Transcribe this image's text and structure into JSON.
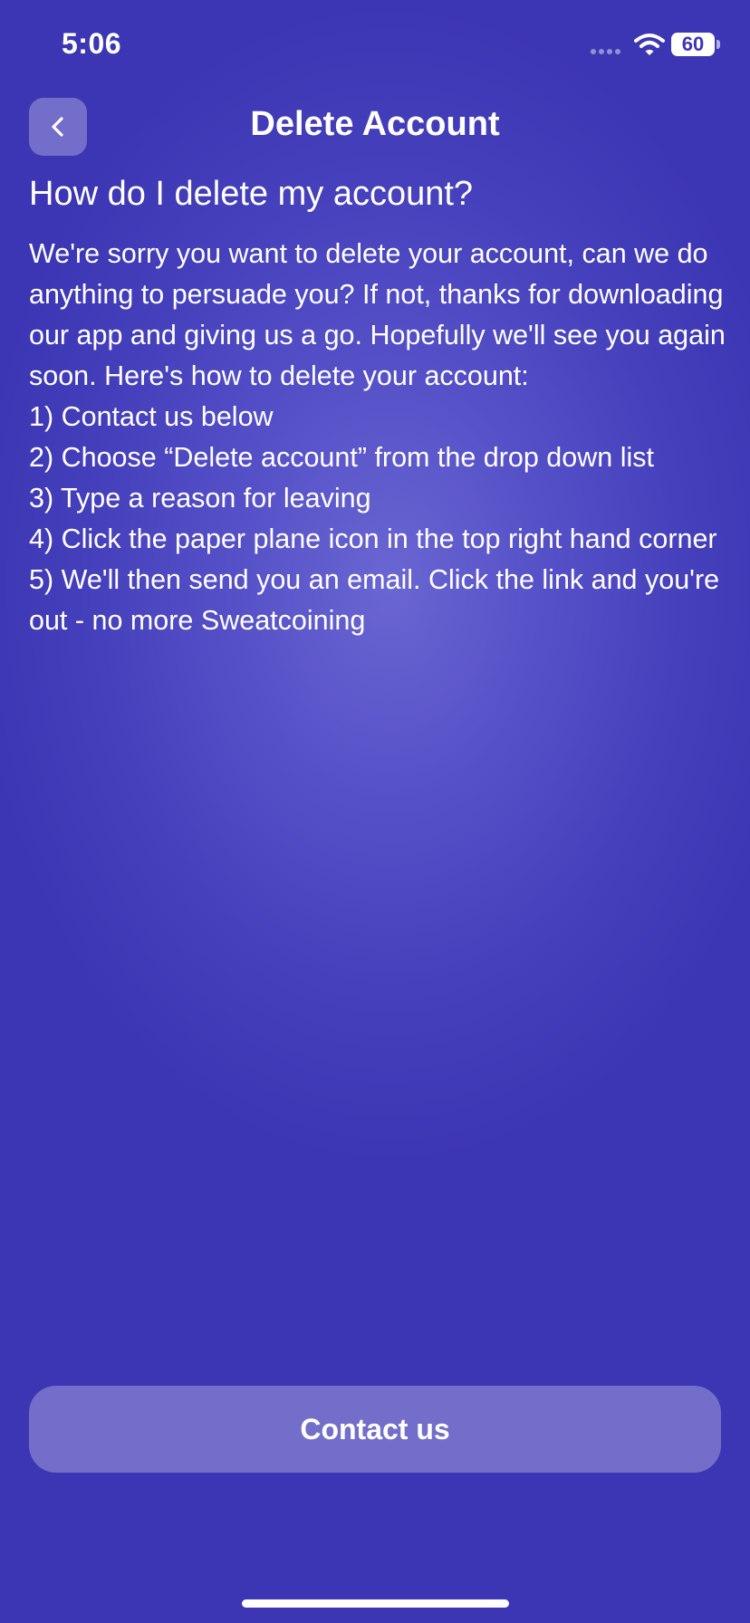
{
  "status_bar": {
    "time": "5:06",
    "battery": "60",
    "icons": [
      "cellular-icon",
      "wifi-icon",
      "battery-icon"
    ]
  },
  "nav": {
    "title": "Delete Account",
    "back_icon": "chevron-left-icon"
  },
  "content": {
    "heading": "How do I delete my account?",
    "intro": "We're sorry you want to delete your account, can we do anything to persuade you? If not, thanks for downloading our app and giving us a go. Hopefully we'll see you again soon. Here's how to delete your account:",
    "steps": [
      "1) Contact us below",
      "2) Choose “Delete account” from the drop down list",
      "3) Type a reason for leaving",
      "4) Click the paper plane icon in the top right hand corner",
      "5) We'll then send you an email. Click the link and you're out - no more Sweatcoining"
    ]
  },
  "footer": {
    "contact_label": "Contact us"
  },
  "colors": {
    "background": "#3d36b4",
    "background_glow": "#6a66d2",
    "text": "#ffffff"
  }
}
